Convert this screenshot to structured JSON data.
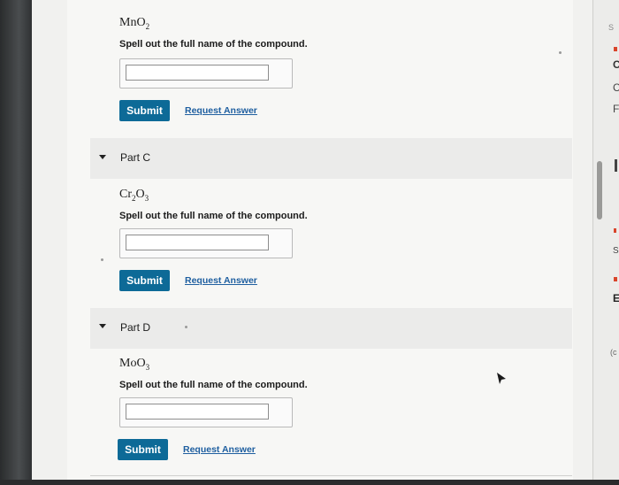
{
  "partB": {
    "formula": {
      "base1": "MnO",
      "sub1": "2",
      "base2": "",
      "sub2": ""
    },
    "prompt": "Spell out the full name of the compound.",
    "submit": "Submit",
    "request": "Request Answer"
  },
  "partC": {
    "label": "Part C",
    "formula": {
      "base1": "Cr",
      "sub1": "2",
      "base2": "O",
      "sub2": "3"
    },
    "prompt": "Spell out the full name of the compound.",
    "submit": "Submit",
    "request": "Request Answer"
  },
  "partD": {
    "label": "Part D",
    "formula": {
      "base1": "MoO",
      "sub1": "3",
      "base2": "",
      "sub2": ""
    },
    "prompt": "Spell out the full name of the compound.",
    "submit": "Submit",
    "request": "Request Answer"
  },
  "right_pane": {
    "letters": [
      "S",
      "C",
      "C",
      "F",
      "S",
      "E",
      "(c"
    ]
  },
  "colors": {
    "submit_bg": "#0d6a97",
    "link": "#1f5fa0",
    "accent_mark": "#d8452b"
  }
}
